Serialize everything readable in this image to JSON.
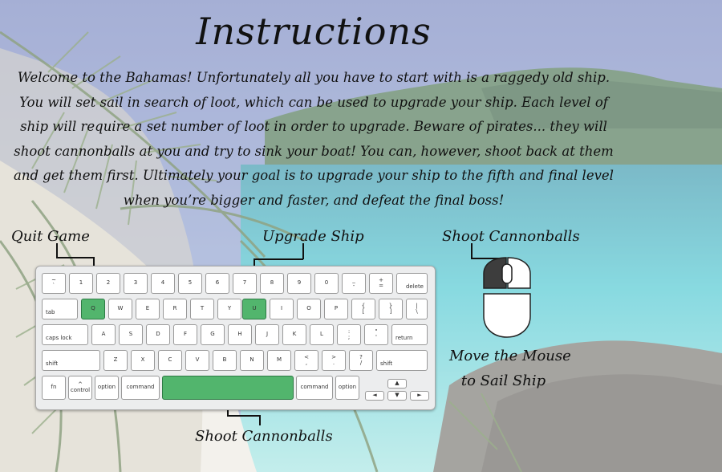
{
  "title": "Instructions",
  "intro": "Welcome to the Bahamas! Unfortunately all you have to start with is a raggedy old ship. You will set sail in search of loot, which can be used to upgrade your ship. Each level of ship will require a set number of loot in order to upgrade. Beware of pirates... they will shoot cannonballs at you and try to sink your boat! You can, however, shoot back at them and get them first. Ultimately your goal is to upgrade your ship to the fifth and final level when you’re bigger and faster, and defeat the final boss!",
  "controls": {
    "quit": {
      "label": "Quit Game",
      "key": "Q"
    },
    "upgrade": {
      "label": "Upgrade Ship",
      "key": "U"
    },
    "shoot_keyboard": {
      "label": "Shoot Cannonballs",
      "key": "space"
    },
    "shoot_mouse": {
      "label": "Shoot Cannonballs",
      "button": "left-mouse-button"
    },
    "move": {
      "label_line1": "Move the Mouse",
      "label_line2": "to Sail Ship"
    }
  },
  "keyboard": {
    "highlight_color": "#52b56d",
    "row1": [
      {
        "top": "~",
        "bottom": "`"
      },
      {
        "label": "1"
      },
      {
        "label": "2"
      },
      {
        "label": "3"
      },
      {
        "label": "4"
      },
      {
        "label": "5"
      },
      {
        "label": "6"
      },
      {
        "label": "7"
      },
      {
        "label": "8"
      },
      {
        "label": "9"
      },
      {
        "label": "0"
      },
      {
        "top": "_",
        "bottom": "-"
      },
      {
        "top": "+",
        "bottom": "="
      },
      {
        "label": "delete"
      }
    ],
    "row2": [
      {
        "label": "tab"
      },
      {
        "label": "Q"
      },
      {
        "label": "W"
      },
      {
        "label": "E"
      },
      {
        "label": "R"
      },
      {
        "label": "T"
      },
      {
        "label": "Y"
      },
      {
        "label": "U"
      },
      {
        "label": "I"
      },
      {
        "label": "O"
      },
      {
        "label": "P"
      },
      {
        "top": "{",
        "bottom": "["
      },
      {
        "top": "}",
        "bottom": "]"
      },
      {
        "top": "|",
        "bottom": "\\"
      }
    ],
    "row3": [
      {
        "label": "caps lock"
      },
      {
        "label": "A"
      },
      {
        "label": "S"
      },
      {
        "label": "D"
      },
      {
        "label": "F"
      },
      {
        "label": "G"
      },
      {
        "label": "H"
      },
      {
        "label": "J"
      },
      {
        "label": "K"
      },
      {
        "label": "L"
      },
      {
        "top": ":",
        "bottom": ";"
      },
      {
        "top": "\"",
        "bottom": "'"
      },
      {
        "label": "return"
      }
    ],
    "row4": [
      {
        "label": "shift"
      },
      {
        "label": "Z"
      },
      {
        "label": "X"
      },
      {
        "label": "C"
      },
      {
        "label": "V"
      },
      {
        "label": "B"
      },
      {
        "label": "N"
      },
      {
        "label": "M"
      },
      {
        "top": "<",
        "bottom": ","
      },
      {
        "top": ">",
        "bottom": "."
      },
      {
        "top": "?",
        "bottom": "/"
      },
      {
        "label": "shift"
      }
    ],
    "row5": [
      {
        "label": "fn"
      },
      {
        "top": "^",
        "bottom": "control"
      },
      {
        "label": "option"
      },
      {
        "label": "command"
      },
      {
        "label": ""
      },
      {
        "label": "command"
      },
      {
        "label": "option"
      }
    ],
    "arrows": {
      "up": "▲",
      "left": "◄",
      "down": "▼",
      "right": "►"
    }
  },
  "mouse": {
    "left_button_color": "#3d3d3d"
  },
  "scene_colors": {
    "sky": "#7e93c4",
    "sea": "#3fc3ce",
    "sand": "#ece8e1",
    "rock": "#6f6c66",
    "palm": "#4c6b38"
  }
}
